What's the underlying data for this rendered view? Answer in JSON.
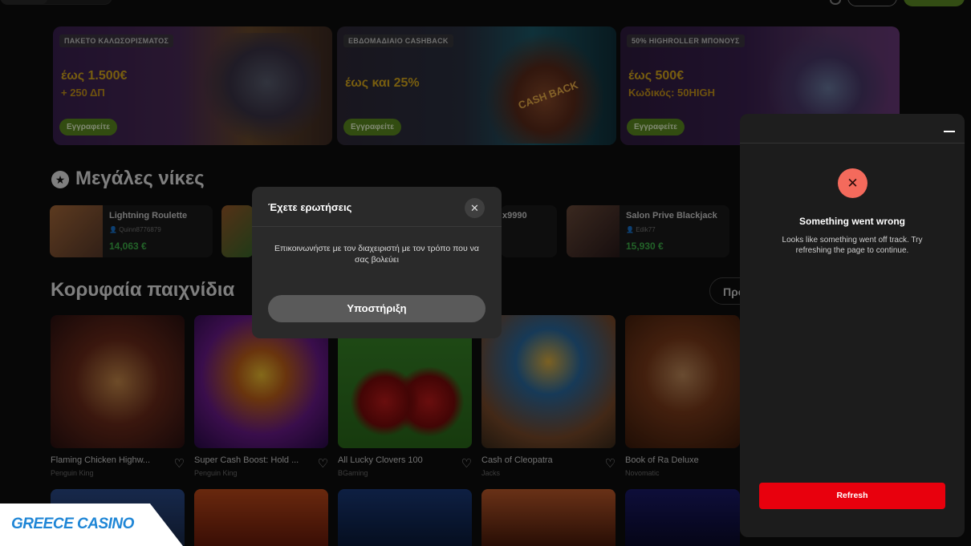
{
  "promos": [
    {
      "tag": "ΠΑΚΕΤΟ ΚΑΛΩΣΟΡΙΣΜΑΤΟΣ",
      "amount": "έως 1.500€",
      "sub": "+ 250 ΔΠ",
      "button": "Εγγραφείτε"
    },
    {
      "tag": "ΕΒΔΟΜΑΔΙΑΙΟ CASHBACK",
      "amount": "έως και 25%",
      "sub": "",
      "button": "Εγγραφείτε",
      "art_label": "CASH BACK"
    },
    {
      "tag": "50% HIGHROLLER ΜΠΟΝΟΥΣ",
      "amount": "έως 500€",
      "sub": "Κωδικός: 50HIGH",
      "button": "Εγγραφείτε"
    }
  ],
  "big_wins": {
    "title": "Μεγάλες νίκες",
    "items": [
      {
        "game": "Lightning Roulette",
        "user": "Quinn8776879",
        "amount": "14,063 €"
      },
      {
        "game": "",
        "user": "",
        "amount": ""
      },
      {
        "game": "x9990",
        "user": "",
        "amount": ""
      },
      {
        "game": "Salon Prive Blackjack",
        "user": "Edik77",
        "amount": "15,930 €"
      }
    ]
  },
  "top_games": {
    "title": "Κορυφαία παιχνίδια",
    "more": "Προ",
    "items": [
      {
        "name": "Flaming Chicken Highw...",
        "provider": "Penguin King"
      },
      {
        "name": "Super Cash Boost: Hold ...",
        "provider": "Penguin King"
      },
      {
        "name": "All Lucky Clovers 100",
        "provider": "BGaming"
      },
      {
        "name": "Cash of Cleopatra",
        "provider": "Jacks"
      },
      {
        "name": "Book of Ra Deluxe",
        "provider": "Novomatic"
      }
    ]
  },
  "modal": {
    "title": "Έχετε ερωτήσεις",
    "close": "✕",
    "text": "Επικοινωνήστε με τον διαχειριστή με τον τρόπο που να σας βολεύει",
    "button": "Υποστήριξη"
  },
  "error_panel": {
    "icon": "✕",
    "title": "Something went wrong",
    "text": "Looks like something went off track. Try refreshing the page to continue.",
    "button": "Refresh"
  },
  "logo": {
    "text": "GREECE CASINO"
  },
  "colors": {
    "accent_green": "#5b8a1f",
    "win_green": "#3fb24a",
    "gold": "#d9a91d",
    "error_red": "#e8000d",
    "error_icon": "#f46a5c"
  }
}
